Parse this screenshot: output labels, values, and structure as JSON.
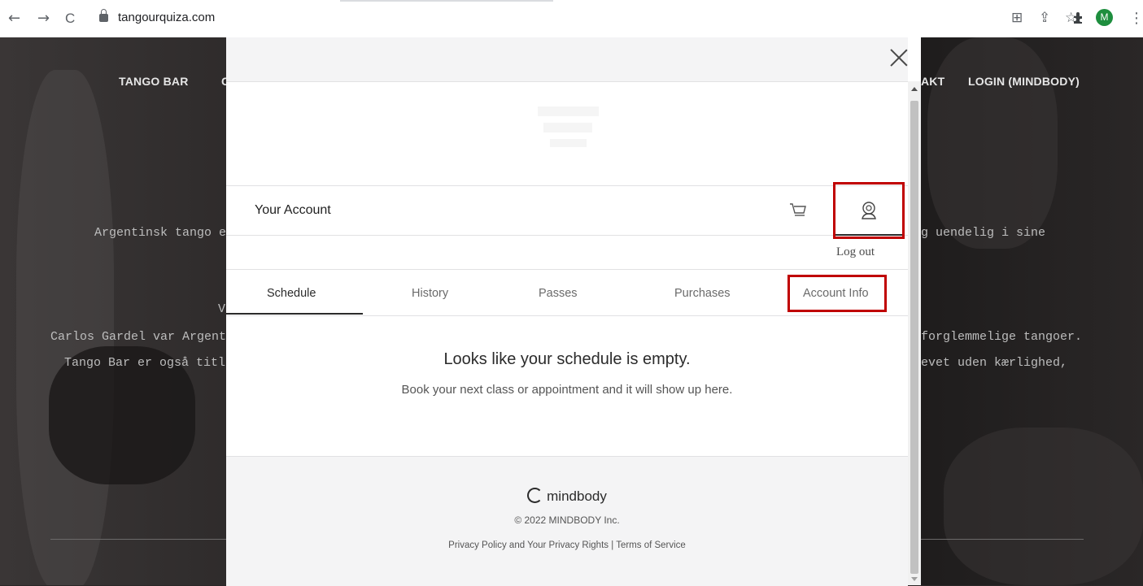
{
  "browser": {
    "back_icon": "←",
    "forward_icon": "→",
    "reload_icon": "C",
    "url": "tangourquiza.com",
    "profile_initial": "M",
    "icons": [
      "translate-icon",
      "share-icon",
      "star-icon",
      "extensions-icon",
      "menu-icon"
    ]
  },
  "site": {
    "nav_left": "TANGO BAR",
    "nav_left_partial": "C",
    "nav_right_partial": "AKT",
    "nav_login": "LOGIN (MINDBODY)",
    "text_line1_left": "Argentinsk tango e",
    "text_line1_right": "g uendelig i sine",
    "text_line2_left": "V",
    "text_line3_left": "Carlos Gardel var Argenti",
    "text_line3_right": "forglemmelige tangoer.",
    "text_line4_left": "Tango Bar er også titler",
    "text_line4_right": "evet uden kærlighed,"
  },
  "modal": {
    "account_title": "Your Account",
    "logout": "Log out",
    "tabs": [
      {
        "label": "Schedule",
        "active": true
      },
      {
        "label": "History",
        "active": false
      },
      {
        "label": "Passes",
        "active": false
      },
      {
        "label": "Purchases",
        "active": false
      },
      {
        "label": "Account Info",
        "active": false
      }
    ],
    "empty_title": "Looks like your schedule is empty.",
    "empty_subtitle": "Book your next class or appointment and it will show up here.",
    "footer_brand": "mindbody",
    "copyright": "© 2022 MINDBODY Inc.",
    "footer_links": "Privacy Policy and Your Privacy Rights | Terms of Service"
  },
  "colors": {
    "highlight": "#c00000",
    "profile_avatar": "#1e8e3e"
  }
}
